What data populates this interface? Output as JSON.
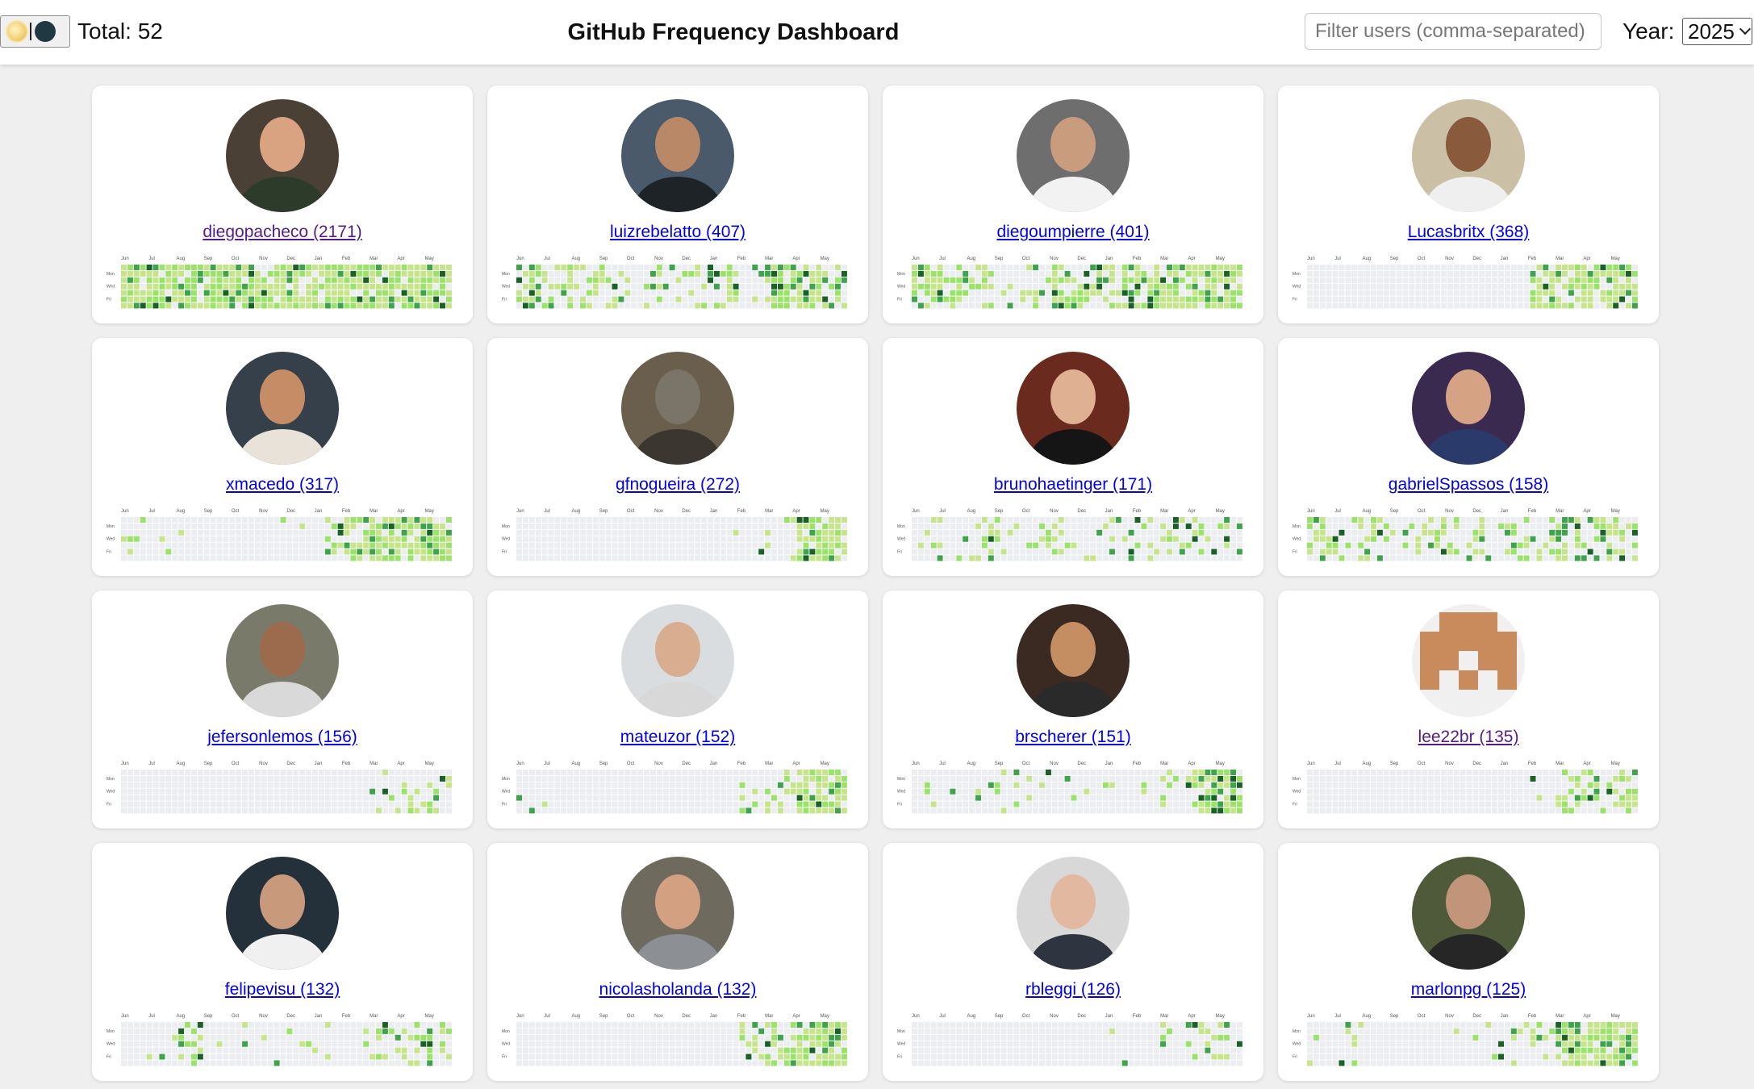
{
  "header": {
    "total_label": "Total: 52",
    "title": "GitHub Frequency Dashboard",
    "filter_placeholder": "Filter users (comma-separated)",
    "year_label": "Year:",
    "year_value": "2025"
  },
  "colors": {
    "empty": "#ebedf0",
    "level1": "#c6e48b",
    "level2": "#9be26b",
    "level3": "#3fa34d",
    "level4": "#196127",
    "link": "#0000ee",
    "visited": "#551a8b"
  },
  "heatmap": {
    "months": [
      "Jun",
      "Jul",
      "Aug",
      "Sep",
      "Oct",
      "Nov",
      "Dec",
      "Jan",
      "Feb",
      "Mar",
      "Apr",
      "May"
    ],
    "days": [
      "Mon",
      "Wed",
      "Fri"
    ]
  },
  "users": [
    {
      "label": "diegopacheco (2171)",
      "visited": true,
      "skin": "#d9a382",
      "shirt": "#2d3b2a",
      "bg": "#4a4036",
      "activity": [
        0.9,
        0.9,
        0.9,
        0.9,
        0.9,
        0.9,
        0.9,
        0.9,
        0.9,
        0.9,
        0.95,
        0.95
      ]
    },
    {
      "label": "luizrebelatto (407)",
      "visited": false,
      "skin": "#b98866",
      "shirt": "#1e2328",
      "bg": "#4a5a6a",
      "activity": [
        0.6,
        0.5,
        0.3,
        0.4,
        0.3,
        0.3,
        0.4,
        0.4,
        0.2,
        0.7,
        0.8,
        0.6
      ]
    },
    {
      "label": "diegoumpierre (401)",
      "visited": false,
      "skin": "#c99c7e",
      "shirt": "#f2f2f2",
      "bg": "#6e6e6e",
      "activity": [
        0.7,
        0.5,
        0.3,
        0.1,
        0.2,
        0.6,
        0.7,
        0.8,
        0.8,
        0.8,
        0.85,
        0.85
      ]
    },
    {
      "label": "Lucasbritx (368)",
      "visited": false,
      "skin": "#8a5a3c",
      "shirt": "#efefef",
      "bg": "#cbbfa5",
      "activity": [
        0,
        0,
        0,
        0,
        0,
        0,
        0,
        0,
        0.8,
        0.85,
        0.85,
        0.85
      ]
    },
    {
      "label": "xmacedo (317)",
      "visited": false,
      "skin": "#c58c66",
      "shirt": "#e8e2d8",
      "bg": "#35404a",
      "activity": [
        0.1,
        0.1,
        0.05,
        0,
        0.02,
        0.05,
        0.05,
        0.3,
        0.7,
        0.8,
        0.8,
        0.75
      ]
    },
    {
      "label": "gfnogueira (272)",
      "visited": false,
      "skin": "#7a7568",
      "shirt": "#3b3730",
      "bg": "#6a5e4c",
      "activity": [
        0,
        0,
        0,
        0,
        0,
        0,
        0,
        0.02,
        0.05,
        0.2,
        0.8,
        0.85
      ]
    },
    {
      "label": "brunohaetinger (171)",
      "visited": false,
      "skin": "#e0b093",
      "shirt": "#151515",
      "bg": "#6b2a1e",
      "activity": [
        0.2,
        0.1,
        0.25,
        0.15,
        0.4,
        0.35,
        0.2,
        0.3,
        0.35,
        0.25,
        0.2,
        0.15
      ]
    },
    {
      "label": "gabrielSpassos (158)",
      "visited": false,
      "skin": "#d5a283",
      "shirt": "#2a3a6a",
      "bg": "#3a2a50",
      "activity": [
        0.6,
        0.3,
        0.4,
        0.2,
        0.3,
        0.2,
        0.3,
        0.4,
        0.35,
        0.4,
        0.45,
        0.45
      ]
    },
    {
      "label": "jefersonlemos (156)",
      "visited": false,
      "skin": "#9c6a4c",
      "shirt": "#d9d9d9",
      "bg": "#7a7a6a",
      "activity": [
        0,
        0,
        0,
        0,
        0,
        0,
        0,
        0,
        0.05,
        0.2,
        0.3,
        0.3
      ]
    },
    {
      "label": "mateuzor (152)",
      "visited": false,
      "skin": "#d9ad90",
      "shirt": "#d8d8d8",
      "bg": "#dadde0",
      "activity": [
        0.05,
        0,
        0.02,
        0,
        0,
        0,
        0,
        0,
        0.15,
        0.5,
        0.85,
        0.8
      ]
    },
    {
      "label": "brscherer (151)",
      "visited": false,
      "skin": "#c58e62",
      "shirt": "#2a2a2a",
      "bg": "#3a2a22",
      "activity": [
        0.1,
        0.15,
        0.1,
        0.15,
        0.1,
        0.05,
        0.05,
        0.05,
        0.15,
        0.3,
        0.8,
        0.85
      ]
    },
    {
      "label": "lee22br (135)",
      "visited": true,
      "identicon": true,
      "activity": [
        0,
        0,
        0,
        0,
        0,
        0,
        0,
        0,
        0.1,
        0.5,
        0.6,
        0.5
      ]
    },
    {
      "label": "felipevisu (132)",
      "visited": false,
      "skin": "#c8997a",
      "shirt": "#f0f0f0",
      "bg": "#25313a",
      "activity": [
        0.02,
        0.05,
        0.4,
        0.05,
        0.05,
        0.05,
        0.05,
        0.05,
        0.1,
        0.3,
        0.4,
        0.3
      ]
    },
    {
      "label": "nicolasholanda (132)",
      "visited": false,
      "skin": "#d3a182",
      "shirt": "#8c8f94",
      "bg": "#6e6a5e",
      "activity": [
        0,
        0,
        0,
        0,
        0,
        0,
        0,
        0,
        0.5,
        0.7,
        0.75,
        0.75
      ]
    },
    {
      "label": "rbleggi (126)",
      "visited": false,
      "skin": "#e3b8a0",
      "shirt": "#2f3540",
      "bg": "#d8d8d8",
      "activity": [
        0,
        0,
        0,
        0,
        0,
        0,
        0.02,
        0.02,
        0.02,
        0.1,
        0.3,
        0.25
      ]
    },
    {
      "label": "marlonpg (125)",
      "visited": false,
      "skin": "#c29479",
      "shirt": "#262626",
      "bg": "#4f5a3a",
      "activity": [
        0.1,
        0.3,
        0.1,
        0,
        0.02,
        0.05,
        0.1,
        0.15,
        0.3,
        0.8,
        0.85,
        0.8
      ]
    }
  ]
}
